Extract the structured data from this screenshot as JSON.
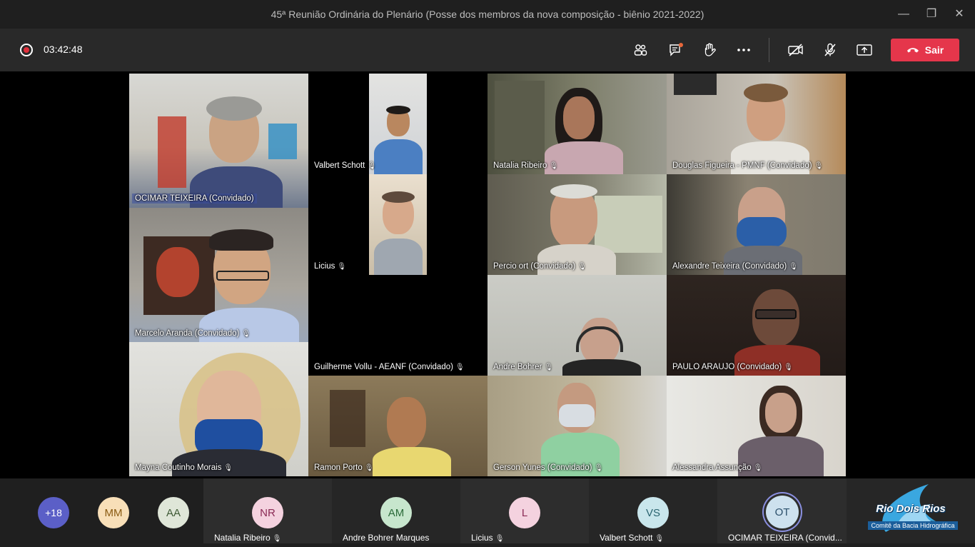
{
  "window": {
    "title": "45ª Reunião Ordinária do Plenário (Posse dos membros da nova composição - biênio 2021-2022)"
  },
  "toolbar": {
    "timer": "03:42:48",
    "leave_label": "Sair"
  },
  "tiles": [
    {
      "name": "OCIMAR TEIXEIRA (Convidado)",
      "bg": "#c9c9c4"
    },
    {
      "name": "Valbert Schott",
      "bg": "#d9d9d7"
    },
    {
      "name": "Natalia Ribeiro",
      "bg": "#6d6f57"
    },
    {
      "name": "Douglas Figueira - PMNF (Convidado)",
      "bg": "#b8b3aa"
    },
    {
      "name": "Licius",
      "bg": "#d9d3c6"
    },
    {
      "name": "Percio ort (Convidado)",
      "bg": "#6d6a5f"
    },
    {
      "name": "Alexandre Teixeira (Convidado)",
      "bg": "#7f7b72"
    },
    {
      "name": "Marcelo Aranda (Convidado)",
      "bg": "#8e8a82"
    },
    {
      "name": "Guilherme Vollu - AEANF (Convidado)",
      "bg": "#000000"
    },
    {
      "name": "Andre Bohrer",
      "bg": "#c6c7c1"
    },
    {
      "name": "PAULO ARAUJO (Convidado)",
      "bg": "#2a201c"
    },
    {
      "name": "Mayna Coutinho Morais",
      "bg": "#d3d3ce"
    },
    {
      "name": "Ramon Porto",
      "bg": "#7a6a4e"
    },
    {
      "name": "Gerson Yunes (Convidado)",
      "bg": "#b3ab95"
    },
    {
      "name": "Alessandra Assunção",
      "bg": "#dad8d3"
    }
  ],
  "roster": {
    "more_count": "+18",
    "initials": [
      {
        "initials": "MM",
        "color": "#f8dfb8"
      },
      {
        "initials": "AA",
        "color": "#dfe6d8"
      }
    ],
    "participants": [
      {
        "initials": "NR",
        "name": "Natalia Ribeiro",
        "color": "#f4d2df"
      },
      {
        "initials": "AM",
        "name": "Andre Bohrer Marques",
        "color": "#c7e6cd"
      },
      {
        "initials": "L",
        "name": "Licius",
        "color": "#f4d2df"
      },
      {
        "initials": "VS",
        "name": "Valbert Schott",
        "color": "#c9e6ec"
      },
      {
        "initials": "OT",
        "name": "OCIMAR TEIXEIRA (Convid...",
        "color": "#cde1ee"
      }
    ],
    "logo_title": "Rio Dois Rios",
    "logo_subtitle": "Comitê da Bacia Hidrográfica"
  }
}
